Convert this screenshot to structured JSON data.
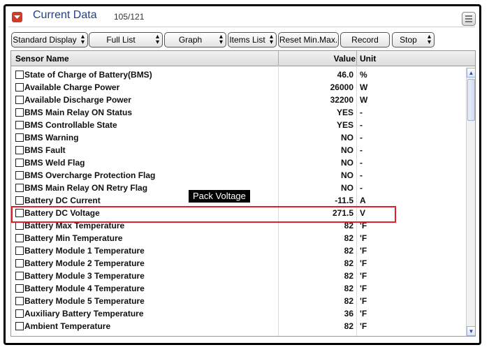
{
  "title": {
    "text": "Current Data",
    "count": "105/121"
  },
  "toolbar": {
    "buttons": [
      {
        "label": "Standard Display",
        "has_arrows": true
      },
      {
        "label": "Full List",
        "has_arrows": true
      },
      {
        "label": "Graph",
        "has_arrows": true
      },
      {
        "label": "Items List",
        "has_arrows": true
      },
      {
        "label": "Reset Min.Max.",
        "has_arrows": false
      },
      {
        "label": "Record",
        "has_arrows": false
      },
      {
        "label": "Stop",
        "has_arrows": true
      }
    ]
  },
  "table": {
    "headers": {
      "name": "Sensor Name",
      "value": "Value",
      "unit": "Unit"
    },
    "rows": [
      {
        "name": "State of Charge of Battery(BMS)",
        "value": "46.0",
        "unit": "%"
      },
      {
        "name": "Available Charge Power",
        "value": "26000",
        "unit": "W"
      },
      {
        "name": "Available Discharge Power",
        "value": "32200",
        "unit": "W"
      },
      {
        "name": "BMS Main Relay ON Status",
        "value": "YES",
        "unit": "-"
      },
      {
        "name": "BMS Controllable State",
        "value": "YES",
        "unit": "-"
      },
      {
        "name": "BMS Warning",
        "value": "NO",
        "unit": "-"
      },
      {
        "name": "BMS Fault",
        "value": "NO",
        "unit": "-"
      },
      {
        "name": "BMS Weld Flag",
        "value": "NO",
        "unit": "-"
      },
      {
        "name": "BMS Overcharge Protection Flag",
        "value": "NO",
        "unit": "-"
      },
      {
        "name": "BMS Main Relay ON Retry Flag",
        "value": "NO",
        "unit": "-"
      },
      {
        "name": "Battery DC Current",
        "value": "-11.5",
        "unit": "A"
      },
      {
        "name": "Battery DC Voltage",
        "value": "271.5",
        "unit": "V"
      },
      {
        "name": "Battery Max Temperature",
        "value": "82",
        "unit": "'F"
      },
      {
        "name": "Battery Min Temperature",
        "value": "82",
        "unit": "'F"
      },
      {
        "name": "Battery Module 1 Temperature",
        "value": "82",
        "unit": "'F"
      },
      {
        "name": "Battery Module 2 Temperature",
        "value": "82",
        "unit": "'F"
      },
      {
        "name": "Battery Module 3 Temperature",
        "value": "82",
        "unit": "'F"
      },
      {
        "name": "Battery Module 4 Temperature",
        "value": "82",
        "unit": "'F"
      },
      {
        "name": "Battery Module 5 Temperature",
        "value": "82",
        "unit": "'F"
      },
      {
        "name": "Auxiliary Battery Temperature",
        "value": "36",
        "unit": "'F"
      },
      {
        "name": "Ambient Temperature",
        "value": "82",
        "unit": "'F"
      }
    ]
  },
  "annotation": {
    "label": "Pack Voltage",
    "highlight_color": "#e0202a"
  },
  "colors": {
    "title": "#1f3f88",
    "accent": "#d23a2a"
  }
}
